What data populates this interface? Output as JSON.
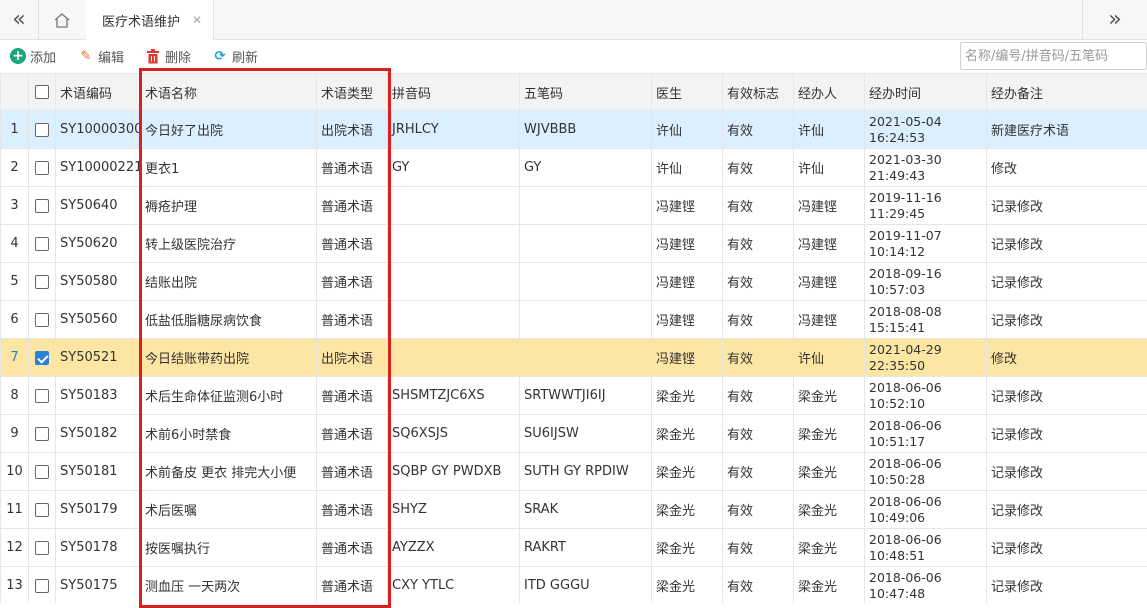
{
  "tabbar": {
    "left_icon": "double-chevron-left",
    "home_icon": "home",
    "right_icon": "double-chevron-right",
    "tab": {
      "label": "医疗术语维护",
      "close_icon": "close"
    }
  },
  "toolbar": {
    "add": {
      "label": "添加",
      "icon": "plus-circle"
    },
    "edit": {
      "label": "编辑",
      "icon": "pencil"
    },
    "delete": {
      "label": "删除",
      "icon": "trash"
    },
    "refresh": {
      "label": "刷新",
      "icon": "refresh"
    },
    "search_placeholder": "名称/编号/拼音码/五笔码"
  },
  "grid": {
    "columns": [
      "",
      "",
      "术语编码",
      "术语名称",
      "术语类型",
      "拼音码",
      "五笔码",
      "医生",
      "有效标志",
      "经办人",
      "经办时间",
      "经办备注"
    ],
    "rows": [
      {
        "n": "1",
        "checked": false,
        "code": "SY10000300",
        "name": "今日好了出院",
        "type": "出院术语",
        "py": "JRHLCY",
        "wb": "WJVBBB",
        "doctor": "许仙",
        "valid": "有效",
        "handler": "许仙",
        "date": "2021-05-04",
        "time": "16:24:53",
        "remark": "新建医疗术语"
      },
      {
        "n": "2",
        "checked": false,
        "code": "SY10000221",
        "name": "更衣1",
        "type": "普通术语",
        "py": "GY",
        "wb": "GY",
        "doctor": "许仙",
        "valid": "有效",
        "handler": "许仙",
        "date": "2021-03-30",
        "time": "21:49:43",
        "remark": "修改"
      },
      {
        "n": "3",
        "checked": false,
        "code": "SY50640",
        "name": "褥疮护理",
        "type": "普通术语",
        "py": "",
        "wb": "",
        "doctor": "冯建铿",
        "valid": "有效",
        "handler": "冯建铿",
        "date": "2019-11-16",
        "time": "11:29:45",
        "remark": "记录修改"
      },
      {
        "n": "4",
        "checked": false,
        "code": "SY50620",
        "name": "转上级医院治疗",
        "type": "普通术语",
        "py": "",
        "wb": "",
        "doctor": "冯建铿",
        "valid": "有效",
        "handler": "冯建铿",
        "date": "2019-11-07",
        "time": "10:14:12",
        "remark": "记录修改"
      },
      {
        "n": "5",
        "checked": false,
        "code": "SY50580",
        "name": "结账出院",
        "type": "普通术语",
        "py": "",
        "wb": "",
        "doctor": "冯建铿",
        "valid": "有效",
        "handler": "冯建铿",
        "date": "2018-09-16",
        "time": "10:57:03",
        "remark": "记录修改"
      },
      {
        "n": "6",
        "checked": false,
        "code": "SY50560",
        "name": "低盐低脂糖尿病饮食",
        "type": "普通术语",
        "py": "",
        "wb": "",
        "doctor": "冯建铿",
        "valid": "有效",
        "handler": "冯建铿",
        "date": "2018-08-08",
        "time": "15:15:41",
        "remark": "记录修改"
      },
      {
        "n": "7",
        "checked": true,
        "code": "SY50521",
        "name": "今日结账带药出院",
        "type": "出院术语",
        "py": "",
        "wb": "",
        "doctor": "冯建铿",
        "valid": "有效",
        "handler": "许仙",
        "date": "2021-04-29",
        "time": "22:35:50",
        "remark": "修改"
      },
      {
        "n": "8",
        "checked": false,
        "code": "SY50183",
        "name": "术后生命体征监测6小时",
        "type": "普通术语",
        "py": "SHSMTZJC6XS",
        "wb": "SRTWWTJI6IJ",
        "doctor": "梁金光",
        "valid": "有效",
        "handler": "梁金光",
        "date": "2018-06-06",
        "time": "10:52:10",
        "remark": "记录修改"
      },
      {
        "n": "9",
        "checked": false,
        "code": "SY50182",
        "name": "术前6小时禁食",
        "type": "普通术语",
        "py": "SQ6XSJS",
        "wb": "SU6IJSW",
        "doctor": "梁金光",
        "valid": "有效",
        "handler": "梁金光",
        "date": "2018-06-06",
        "time": "10:51:17",
        "remark": "记录修改"
      },
      {
        "n": "10",
        "checked": false,
        "code": "SY50181",
        "name": "术前备皮 更衣 排完大小便",
        "type": "普通术语",
        "py": "SQBP GY PWDXB",
        "wb": "SUTH GY RPDIW",
        "doctor": "梁金光",
        "valid": "有效",
        "handler": "梁金光",
        "date": "2018-06-06",
        "time": "10:50:28",
        "remark": "记录修改"
      },
      {
        "n": "11",
        "checked": false,
        "code": "SY50179",
        "name": "术后医嘱",
        "type": "普通术语",
        "py": "SHYZ",
        "wb": "SRAK",
        "doctor": "梁金光",
        "valid": "有效",
        "handler": "梁金光",
        "date": "2018-06-06",
        "time": "10:49:06",
        "remark": "记录修改"
      },
      {
        "n": "12",
        "checked": false,
        "code": "SY50178",
        "name": "按医嘱执行",
        "type": "普通术语",
        "py": "AYZZX",
        "wb": "RAKRT",
        "doctor": "梁金光",
        "valid": "有效",
        "handler": "梁金光",
        "date": "2018-06-06",
        "time": "10:48:51",
        "remark": "记录修改"
      },
      {
        "n": "13",
        "checked": false,
        "code": "SY50175",
        "name": "测血压 一天两次",
        "type": "普通术语",
        "py": "CXY YTLC",
        "wb": "ITD GGGU",
        "doctor": "梁金光",
        "valid": "有效",
        "handler": "梁金光",
        "date": "2018-06-06",
        "time": "10:47:48",
        "remark": "记录修改"
      }
    ]
  },
  "colors": {
    "highlight_row": "#dcefff",
    "selected_row": "#fde6a4",
    "annotation_box": "#d92020",
    "add_icon": "#1aa57a"
  }
}
